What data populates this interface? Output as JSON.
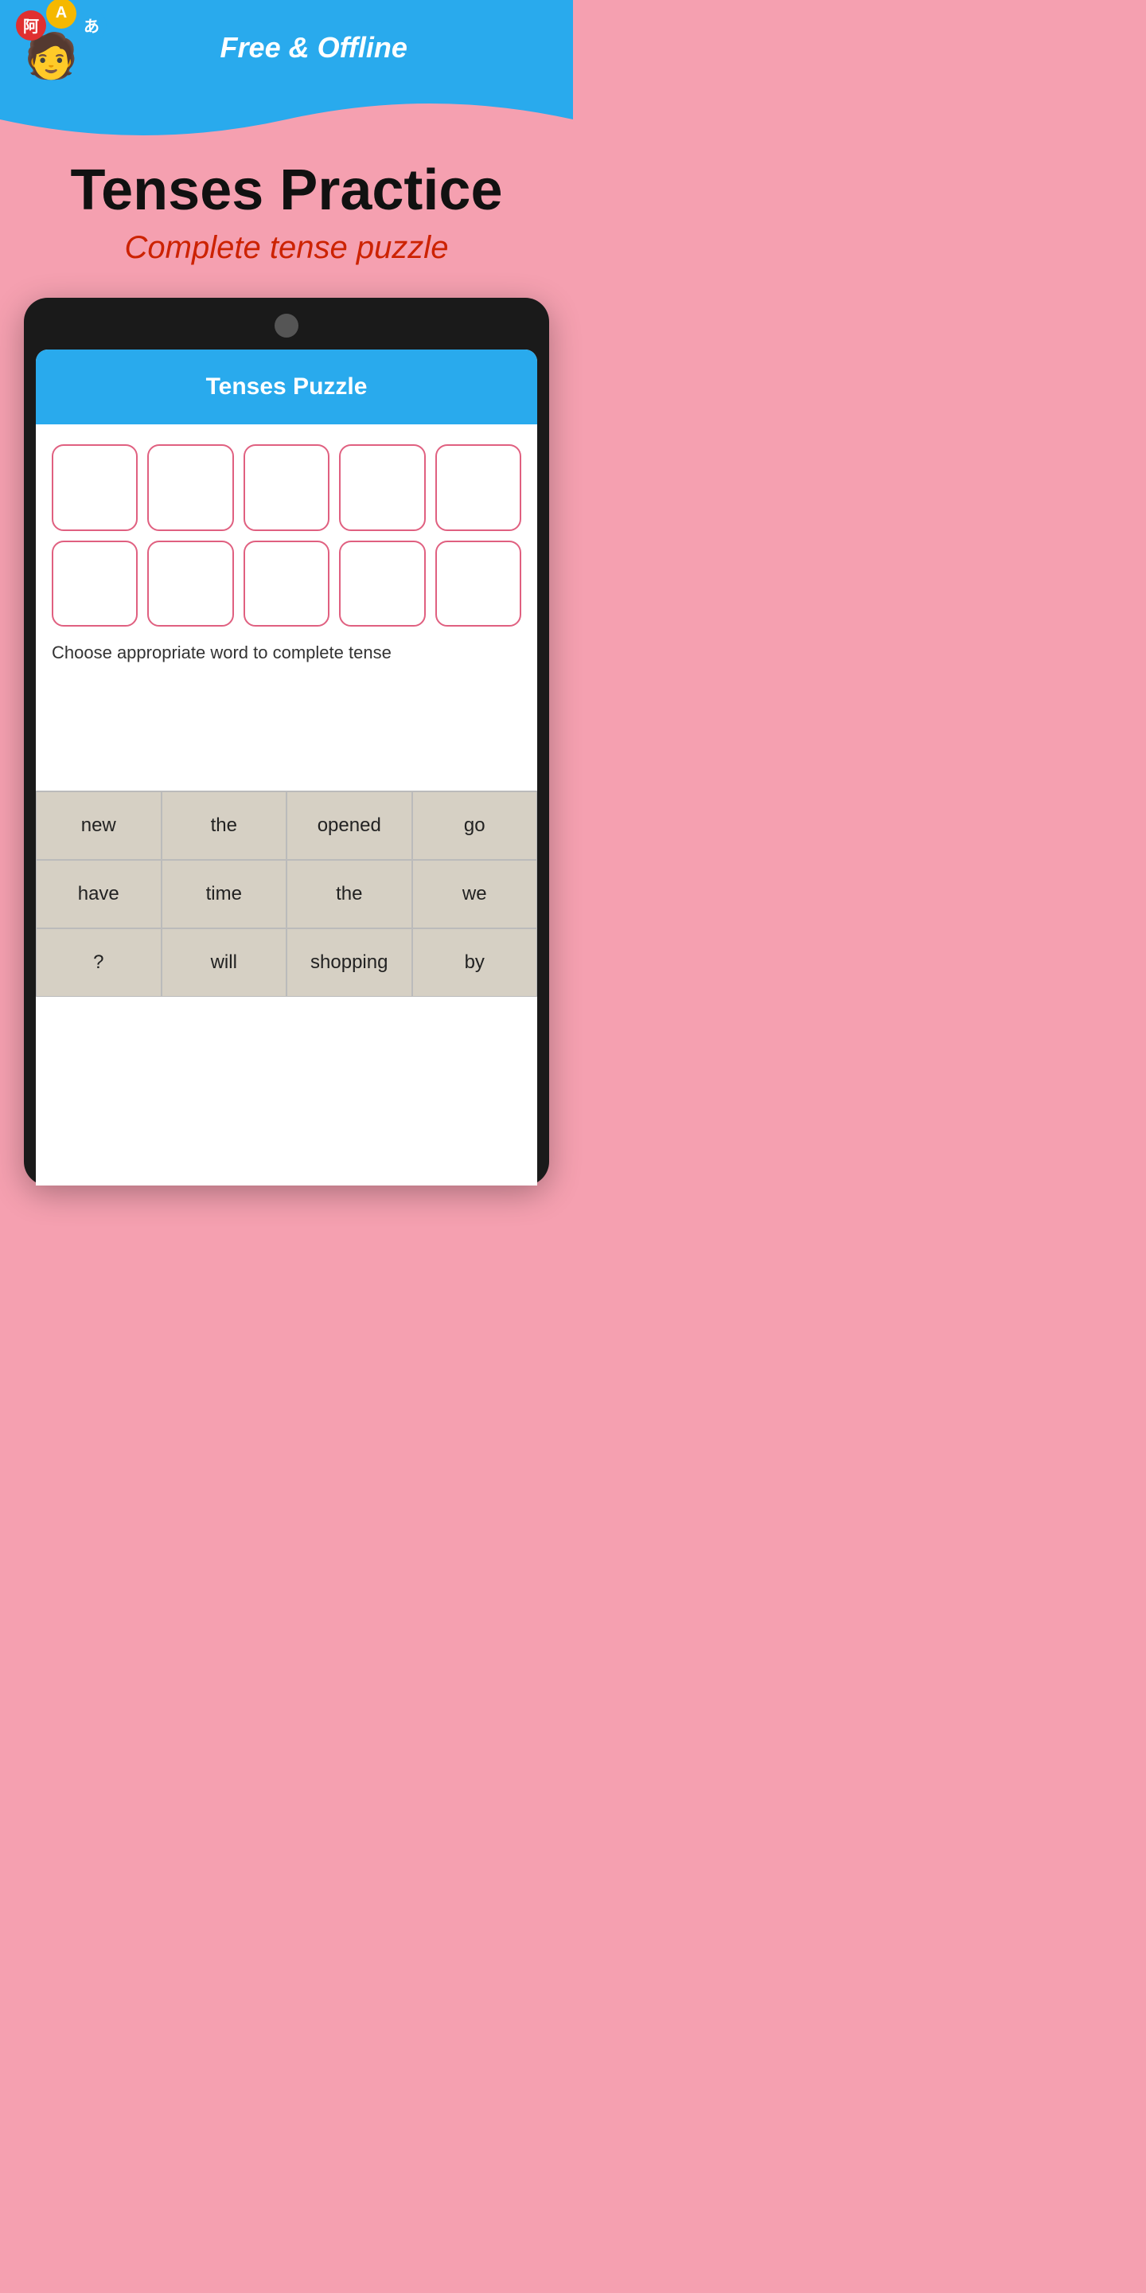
{
  "header": {
    "tagline": "Free & Offline",
    "logo_alt": "Language learning app logo"
  },
  "app": {
    "title": "Tenses Practice",
    "subtitle": "Complete tense puzzle"
  },
  "puzzle": {
    "screen_title": "Tenses Puzzle",
    "grid_rows": 2,
    "grid_cols": 5,
    "instruction": "Choose appropriate word to complete tense"
  },
  "word_buttons": [
    [
      {
        "id": "btn-new",
        "label": "new"
      },
      {
        "id": "btn-the1",
        "label": "the"
      },
      {
        "id": "btn-opened",
        "label": "opened"
      },
      {
        "id": "btn-go",
        "label": "go"
      }
    ],
    [
      {
        "id": "btn-have",
        "label": "have"
      },
      {
        "id": "btn-time",
        "label": "time"
      },
      {
        "id": "btn-the2",
        "label": "the"
      },
      {
        "id": "btn-we",
        "label": "we"
      }
    ],
    [
      {
        "id": "btn-question",
        "label": "?"
      },
      {
        "id": "btn-will",
        "label": "will"
      },
      {
        "id": "btn-shopping",
        "label": "shopping"
      },
      {
        "id": "btn-by",
        "label": "by"
      }
    ]
  ],
  "logo_bubbles": [
    {
      "symbol": "阿",
      "color": "#e03030"
    },
    {
      "symbol": "A",
      "color": "#f5b800"
    },
    {
      "symbol": "あ",
      "color": "#29aaed"
    }
  ]
}
